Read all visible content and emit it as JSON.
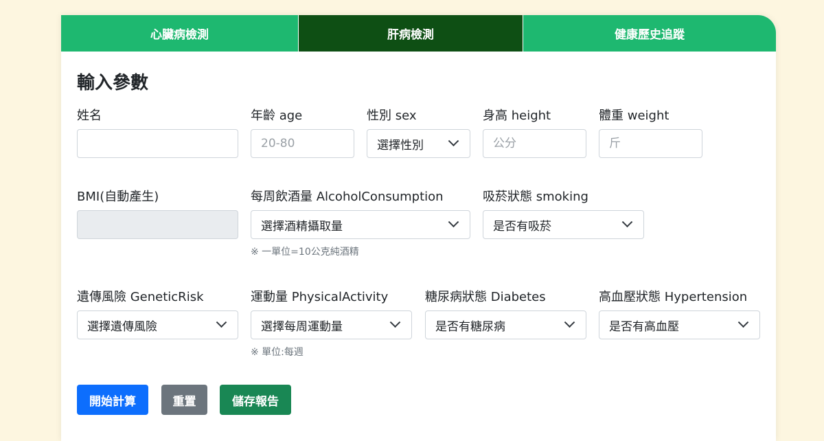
{
  "tabs": [
    {
      "label": "心臟病檢測"
    },
    {
      "label": "肝病檢測"
    },
    {
      "label": "健康歷史追蹤"
    }
  ],
  "active_tab": "肝病檢測",
  "colors": {
    "tab_bg": "#1eb870",
    "tab_active_bg": "#0e4f14",
    "page_bg": "#fdf6e0",
    "primary": "#0d6efd",
    "secondary": "#6c757d",
    "success": "#198754"
  },
  "form": {
    "title": "輸入參數",
    "name": {
      "label": "姓名",
      "value": "",
      "placeholder": ""
    },
    "age": {
      "label": "年齡 age",
      "value": "",
      "placeholder": "20-80"
    },
    "sex": {
      "label": "性別 sex",
      "selected": "選擇性別"
    },
    "height": {
      "label": "身高 height",
      "value": "",
      "placeholder": "公分"
    },
    "weight": {
      "label": "體重 weight",
      "value": "",
      "placeholder": "斤"
    },
    "bmi": {
      "label": "BMI(自動產生)",
      "value": ""
    },
    "alcohol": {
      "label": "每周飲酒量 AlcoholConsumption",
      "selected": "選擇酒精攝取量",
      "hint": "※ 一單位=10公克純酒精"
    },
    "smoking": {
      "label": "吸菸狀態 smoking",
      "selected": "是否有吸菸"
    },
    "genetic": {
      "label": "遺傳風險 GeneticRisk",
      "selected": "選擇遺傳風險"
    },
    "activity": {
      "label": "運動量 PhysicalActivity",
      "selected": "選擇每周運動量",
      "hint": "※ 單位:每週"
    },
    "diabetes": {
      "label": "糖尿病狀態 Diabetes",
      "selected": "是否有糖尿病"
    },
    "hypertension": {
      "label": "高血壓狀態 Hypertension",
      "selected": "是否有高血壓"
    }
  },
  "buttons": {
    "calculate": "開始計算",
    "reset": "重置",
    "save": "儲存報告"
  },
  "icons": {
    "select_arrow": "chevron-down-icon"
  }
}
